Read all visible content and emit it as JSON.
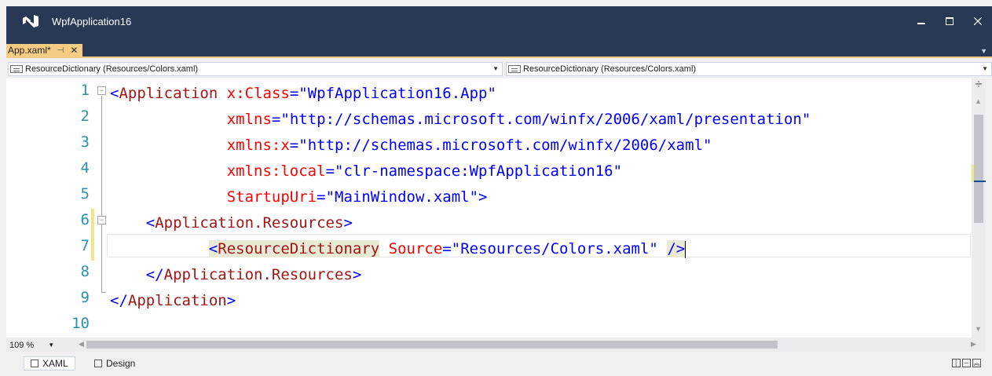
{
  "window": {
    "title": "WpfApplication16",
    "controls": [
      "minimize-icon",
      "maximize-icon",
      "close-icon"
    ]
  },
  "tabs": [
    {
      "label": "App.xaml*",
      "active": true,
      "pinned": false
    }
  ],
  "navbar": {
    "left_dropdown": "ResourceDictionary (Resources/Colors.xaml)",
    "right_dropdown": "ResourceDictionary (Resources/Colors.xaml)"
  },
  "editor": {
    "line_numbers": [
      "1",
      "2",
      "3",
      "4",
      "5",
      "6",
      "7",
      "8",
      "9",
      "10"
    ],
    "current_line": 7,
    "lines": {
      "l1": {
        "open": "<",
        "tag": "Application",
        "attr": "x:Class",
        "eq": "=",
        "value": "\"WpfApplication16.App\""
      },
      "l2": {
        "attr": "xmlns",
        "eq": "=",
        "value": "\"http://schemas.microsoft.com/winfx/2006/xaml/presentation\""
      },
      "l3": {
        "attr": "xmlns:x",
        "eq": "=",
        "value": "\"http://schemas.microsoft.com/winfx/2006/xaml\""
      },
      "l4": {
        "attr": "xmlns:local",
        "eq": "=",
        "value": "\"clr-namespace:WpfApplication16\""
      },
      "l5": {
        "attr": "StartupUri",
        "eq": "=",
        "value": "\"MainWindow.xaml\"",
        "close": ">"
      },
      "l6": {
        "open": "<",
        "tag": "Application.Resources",
        "close": ">"
      },
      "l7": {
        "open": "<",
        "tag": "ResourceDictionary",
        "attr": "Source",
        "eq": "=",
        "value": "\"Resources/Colors.xaml\"",
        "close": "/>"
      },
      "l8": {
        "open": "</",
        "tag": "Application.Resources",
        "close": ">"
      },
      "l9": {
        "open": "</",
        "tag": "Application",
        "close": ">"
      }
    }
  },
  "status": {
    "zoom": "109 %"
  },
  "view_tabs": [
    {
      "label": "XAML",
      "active": true
    },
    {
      "label": "Design",
      "active": false
    }
  ],
  "colors": {
    "titlebar": "#293955",
    "active_tab": "#f5cc84",
    "line_number": "#2b91af",
    "tag": "#a31515",
    "attribute": "#ff0000",
    "value": "#0000ff"
  }
}
